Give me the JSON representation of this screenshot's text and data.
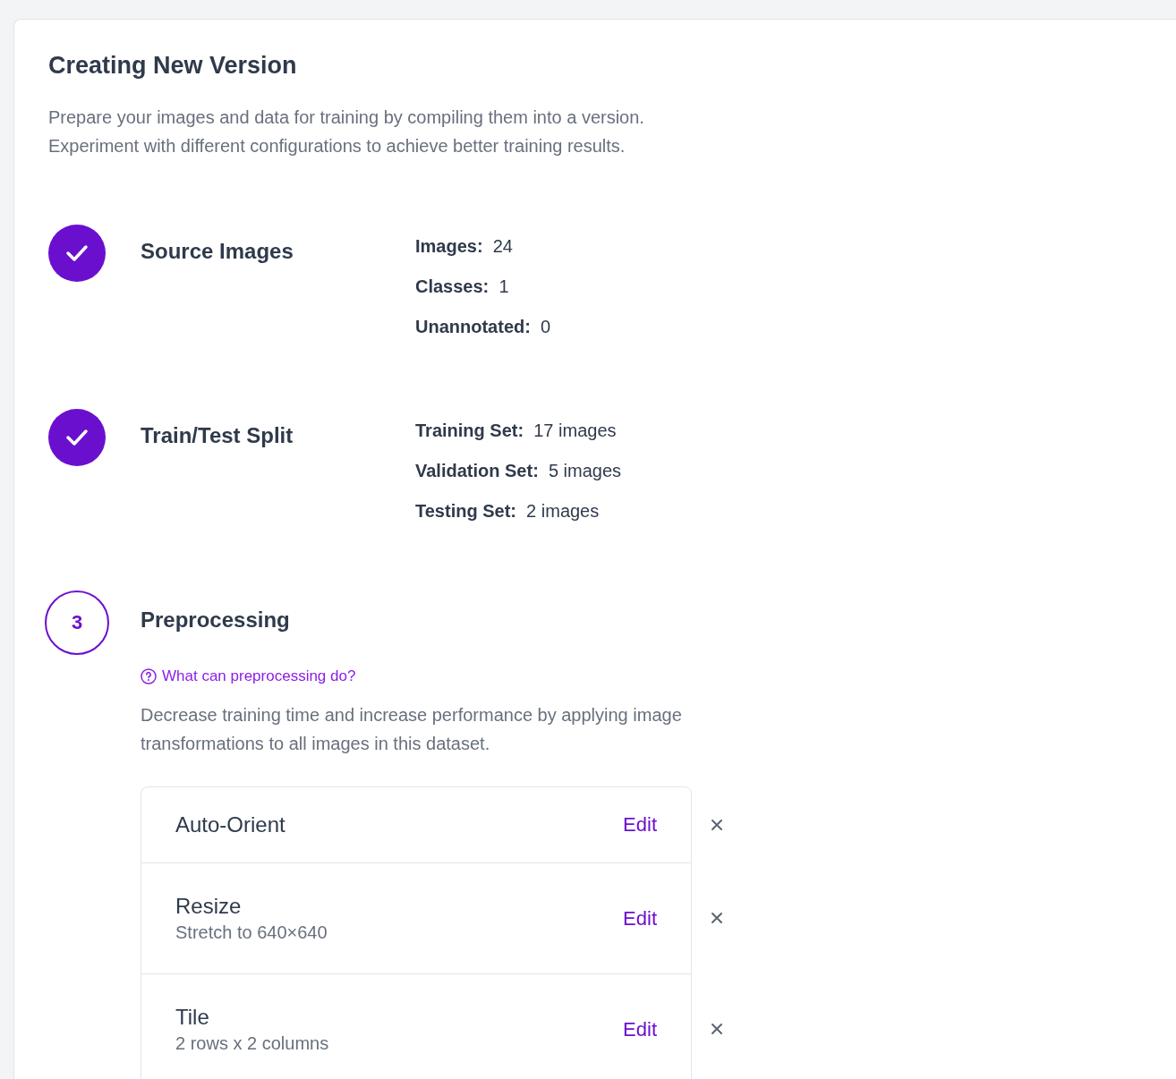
{
  "page": {
    "title": "Creating New Version",
    "intro": [
      "Prepare your images and data for training by compiling them into a version.",
      "Experiment with different configurations to achieve better training results."
    ]
  },
  "steps": [
    {
      "completed": true,
      "title": "Source Images",
      "stats": [
        {
          "label": "Images:",
          "value": "24"
        },
        {
          "label": "Classes:",
          "value": "1"
        },
        {
          "label": "Unannotated:",
          "value": "0"
        }
      ]
    },
    {
      "completed": true,
      "title": "Train/Test Split",
      "stats": [
        {
          "label": "Training Set:",
          "value": "17 images"
        },
        {
          "label": "Validation Set:",
          "value": "5 images"
        },
        {
          "label": "Testing Set:",
          "value": "2 images"
        }
      ]
    },
    {
      "completed": false,
      "number": "3",
      "title": "Preprocessing",
      "help_link": "What can preprocessing do?",
      "description": "Decrease training time and increase performance by applying image transformations to all images in this dataset.",
      "transforms": [
        {
          "name": "Auto-Orient",
          "edit": "Edit"
        },
        {
          "name": "Resize",
          "detail": "Stretch to 640×640",
          "edit": "Edit"
        },
        {
          "name": "Tile",
          "detail": "2 rows x 2 columns",
          "edit": "Edit"
        }
      ]
    }
  ]
}
